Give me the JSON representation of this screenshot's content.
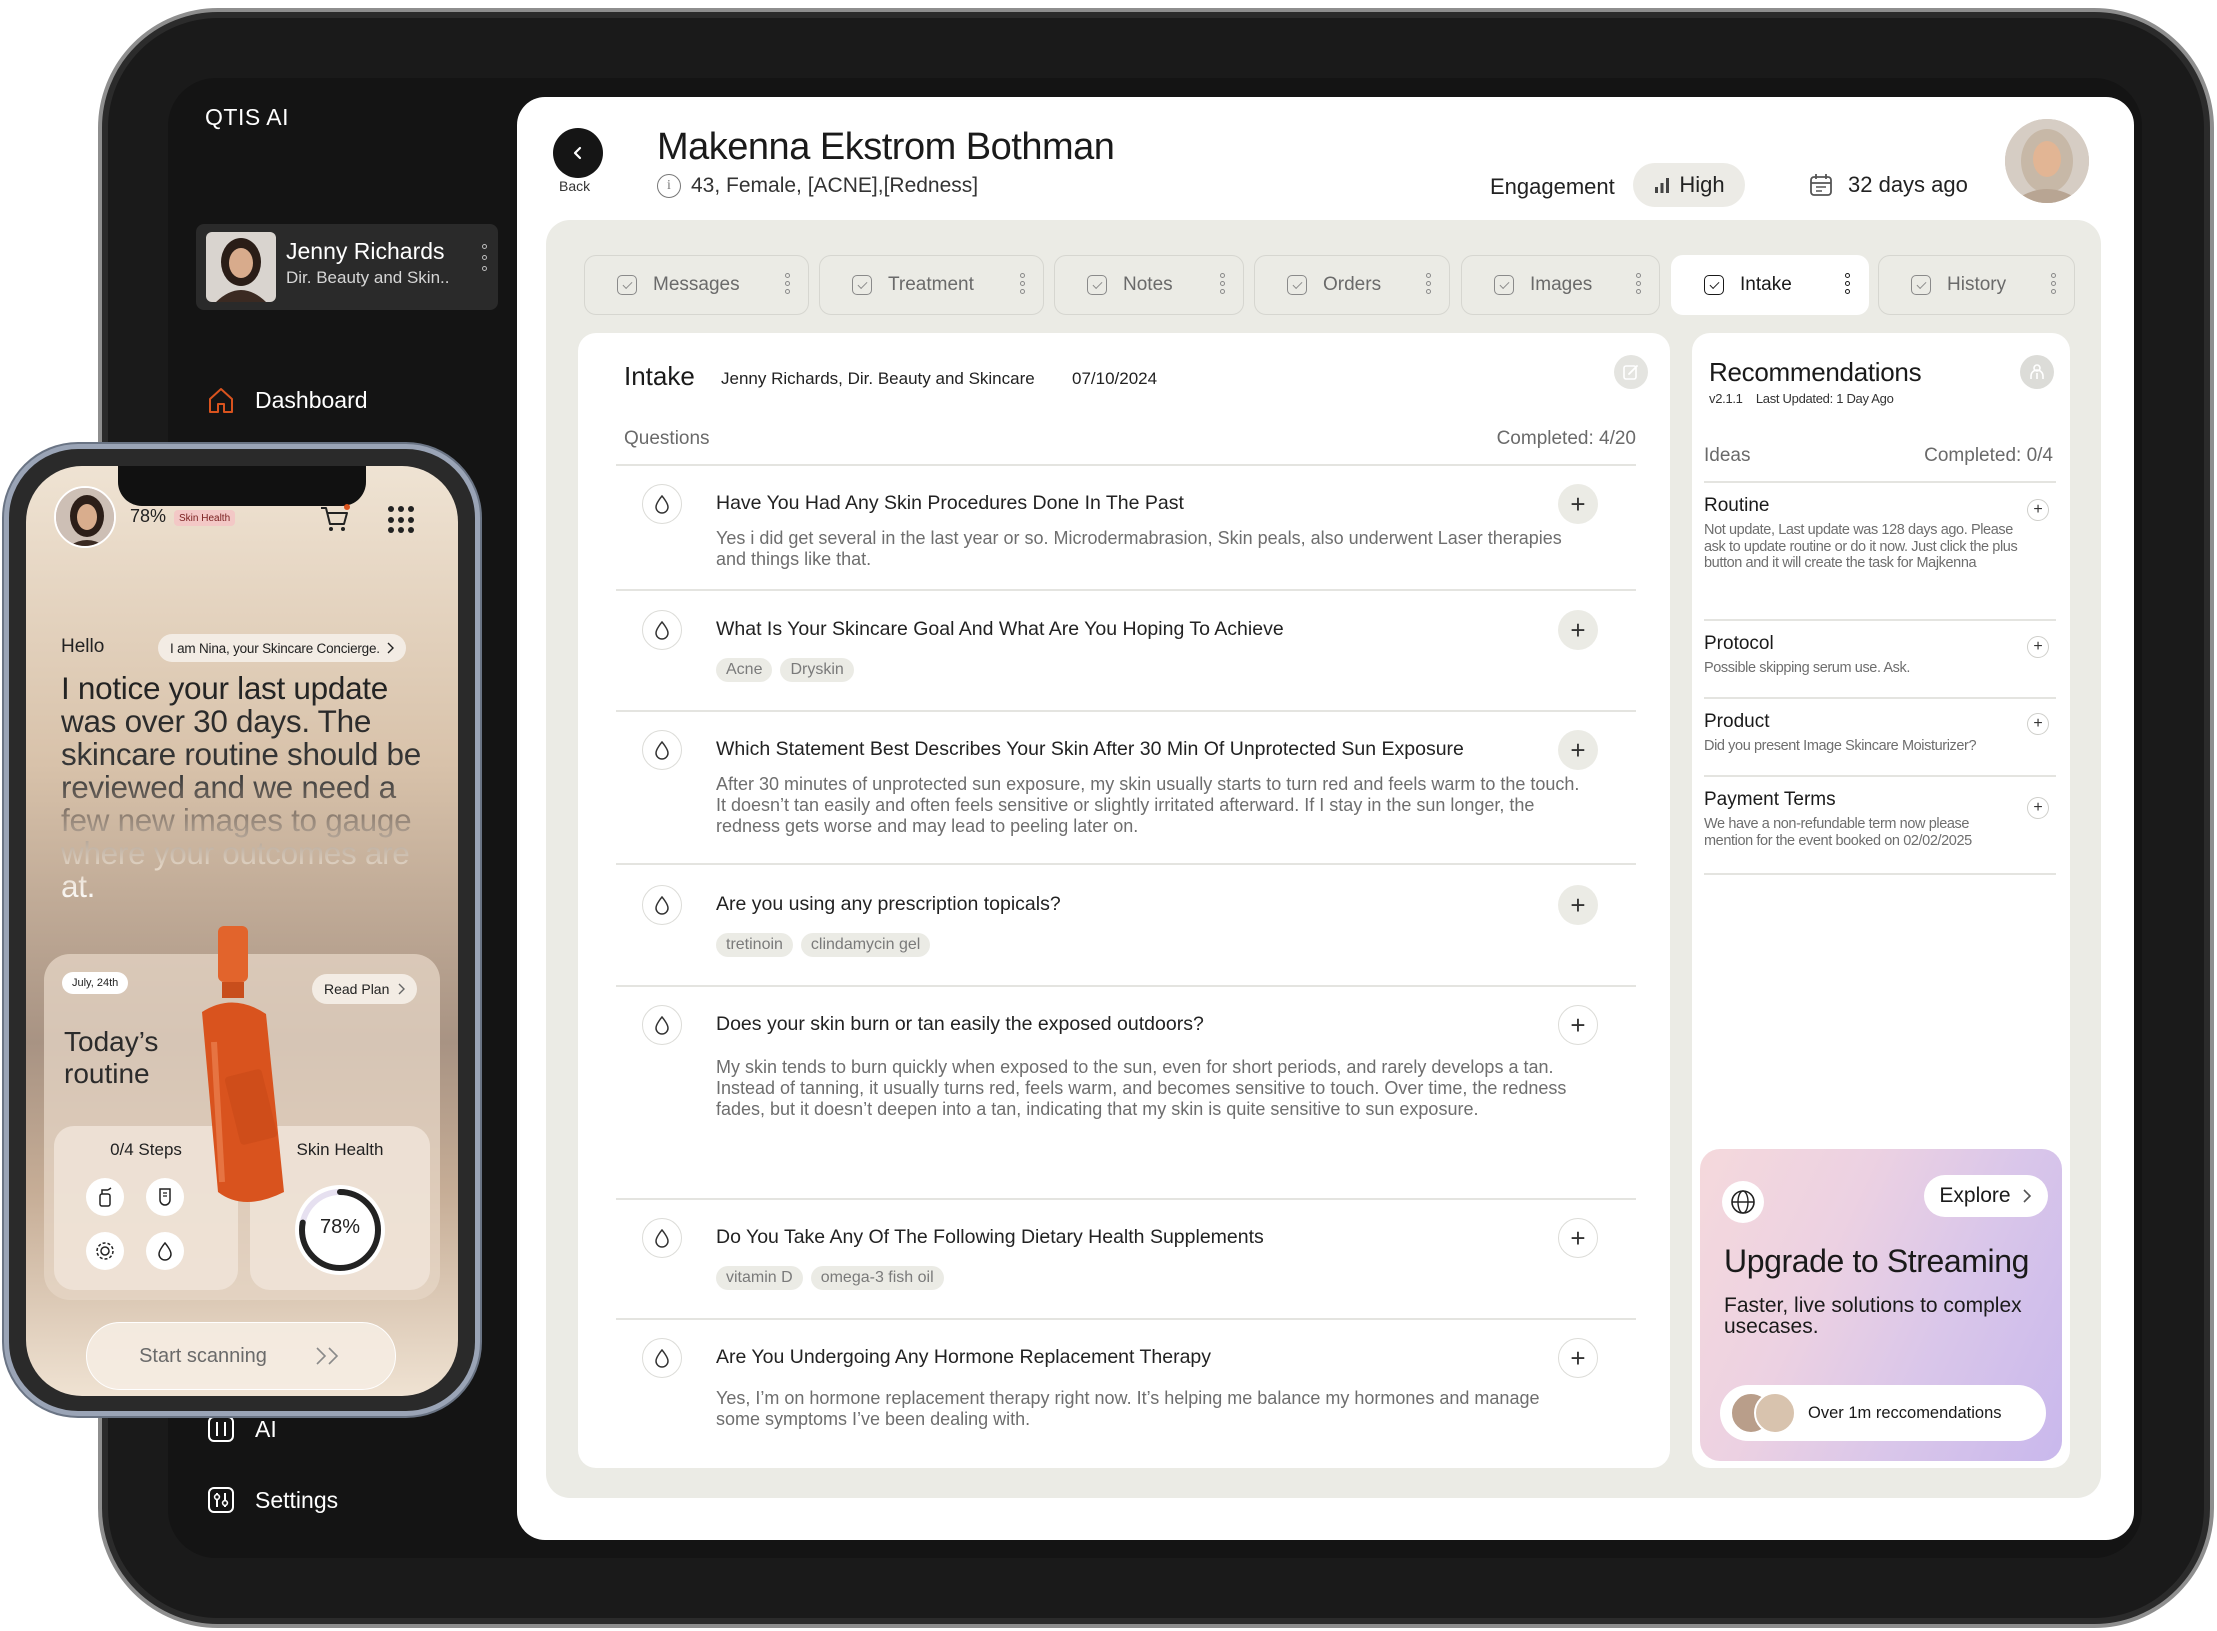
{
  "app": {
    "title": "QTIS AI"
  },
  "current_user": {
    "name": "Jenny Richards",
    "role": "Dir. Beauty and Skin.."
  },
  "nav": {
    "dashboard": "Dashboard",
    "ai": "AI",
    "settings": "Settings"
  },
  "patient": {
    "back_label": "Back",
    "name": "Makenna Ekstrom Bothman",
    "info": "43, Female, [ACNE],[Redness]",
    "engagement_label": "Engagement",
    "engagement_value": "High",
    "last_seen": "32 days ago"
  },
  "tabs": [
    {
      "label": "Messages"
    },
    {
      "label": "Treatment"
    },
    {
      "label": "Notes"
    },
    {
      "label": "Orders"
    },
    {
      "label": "Images"
    },
    {
      "label": "Intake",
      "active": true
    },
    {
      "label": "History"
    }
  ],
  "intake": {
    "title": "Intake",
    "author": "Jenny Richards, Dir. Beauty and Skincare",
    "date": "07/10/2024",
    "questions_label": "Questions",
    "completed": "Completed: 4/20",
    "questions": [
      {
        "title": "Have You Had Any Skin Procedures Done In The Past",
        "answer": "Yes i did get several in the last year or so. Microdermabrasion, Skin peals, also underwent Laser therapies and things like that."
      },
      {
        "title": "What Is Your Skincare Goal And What Are You Hoping To Achieve",
        "tags": [
          "Acne",
          "Dryskin"
        ]
      },
      {
        "title": "Which Statement Best Describes Your Skin After 30 Min Of Unprotected Sun Exposure",
        "answer": "After 30 minutes of unprotected sun exposure, my skin usually starts to turn red and feels warm to the touch. It doesn’t tan easily and often feels sensitive or slightly irritated afterward. If I stay in the sun longer, the redness gets worse and may lead to peeling later on."
      },
      {
        "title": "Are you using any prescription topicals?",
        "tags": [
          "tretinoin",
          "clindamycin gel"
        ]
      },
      {
        "title": "Does your skin burn or tan easily the exposed outdoors?",
        "answer": "My skin tends to burn quickly when exposed to the sun, even for short periods, and rarely develops a tan. Instead of tanning, it usually turns red, feels warm, and becomes sensitive to touch. Over time, the redness fades, but it doesn’t deepen into a tan, indicating that my skin is quite sensitive to sun exposure."
      },
      {
        "title": "Do You Take Any Of The Following Dietary Health Supplements",
        "tags": [
          "vitamin D",
          "omega-3 fish oil"
        ]
      },
      {
        "title": "Are You Undergoing Any Hormone Replacement Therapy",
        "answer": "Yes, I’m on hormone replacement therapy right now. It’s helping me balance my hormones and manage some symptoms I’ve been dealing with."
      }
    ]
  },
  "recommendations": {
    "title": "Recommendations",
    "version": "v2.1.1",
    "last_updated": "Last Updated: 1 Day Ago",
    "ideas_label": "Ideas",
    "completed": "Completed: 0/4",
    "items": [
      {
        "title": "Routine",
        "body": "Not update, Last update was 128 days ago. Please ask to update routine or do it now. Just click the plus button and it will create the task for Majkenna"
      },
      {
        "title": "Protocol",
        "body": "Possible skipping serum use. Ask."
      },
      {
        "title": "Product",
        "body": "Did you present Image Skincare Moisturizer?"
      },
      {
        "title": "Payment Terms",
        "body": "We have a non-refundable term now please mention for the event booked on 02/02/2025"
      }
    ],
    "upgrade": {
      "explore_label": "Explore",
      "title": "Upgrade to Streaming",
      "subtitle": "Faster, live solutions to complex usecases.",
      "social_proof": "Over 1m reccomendations"
    }
  },
  "phone": {
    "health_pct": "78%",
    "health_badge": "Skin Health",
    "hello": "Hello",
    "concierge": "I am Nina, your Skincare Concierge.",
    "message": "I notice your last update was over 30 days. The skincare routine should be reviewed and we need a few new images to gauge where your outcomes are at.",
    "card_date": "July, 24th",
    "read_plan": "Read Plan",
    "today_routine": "Today’s routine",
    "steps": "0/4 Steps",
    "skin_health_label": "Skin Health",
    "skin_health_value": "78%",
    "skin_health_fraction": 0.78,
    "scan_button": "Start scanning"
  },
  "colors": {
    "accent_orange": "#d9531e",
    "sidebar_bg": "#141414",
    "content_bg": "#ebebe5"
  }
}
